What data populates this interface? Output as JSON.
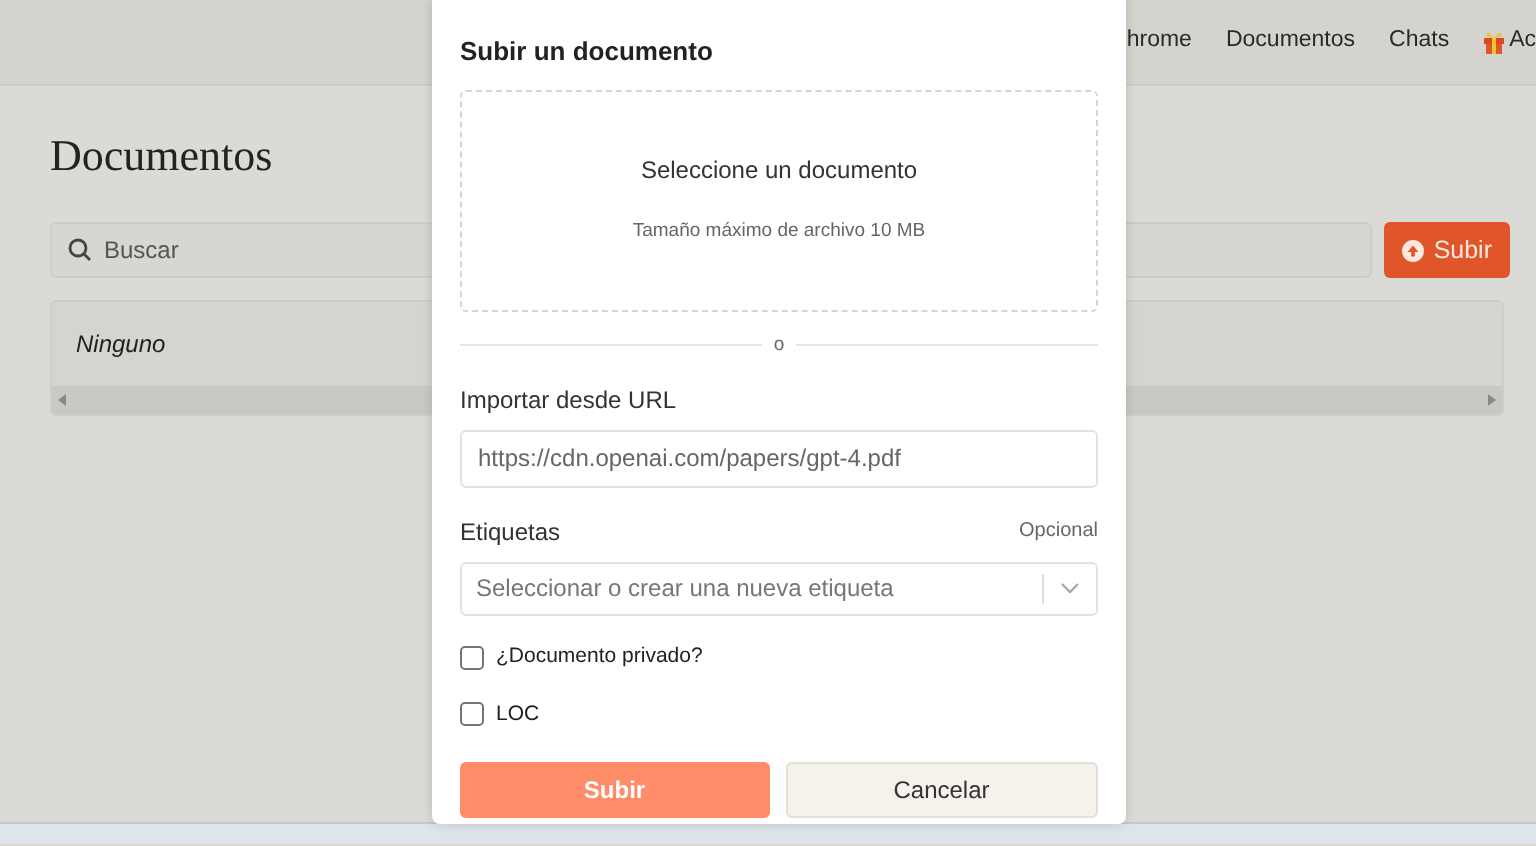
{
  "navbar": {
    "items": [
      {
        "kind": "text",
        "label": "hrome"
      },
      {
        "kind": "text",
        "label": "Documentos"
      },
      {
        "kind": "text",
        "label": "Chats"
      },
      {
        "kind": "gift",
        "label": "Ac"
      }
    ]
  },
  "page": {
    "title": "Documentos",
    "search": {
      "placeholder": "Buscar"
    },
    "upload_button": "Subir",
    "table": {
      "rows": [
        "Ninguno"
      ]
    }
  },
  "modal": {
    "title": "Subir un documento",
    "dropzone": {
      "title": "Seleccione un documento",
      "hint": "Tamaño máximo de archivo 10 MB"
    },
    "divider": "o",
    "url": {
      "label": "Importar desde URL",
      "placeholder": "https://cdn.openai.com/papers/gpt-4.pdf"
    },
    "tags": {
      "label": "Etiquetas",
      "note": "Opcional",
      "placeholder": "Seleccionar o crear una nueva etiqueta"
    },
    "checkboxes": [
      {
        "label": "¿Documento privado?",
        "checked": false
      },
      {
        "label": "LOC",
        "checked": false
      }
    ],
    "buttons": [
      {
        "kind": "primary",
        "label": "Subir"
      },
      {
        "kind": "secondary",
        "label": "Cancelar"
      }
    ]
  }
}
